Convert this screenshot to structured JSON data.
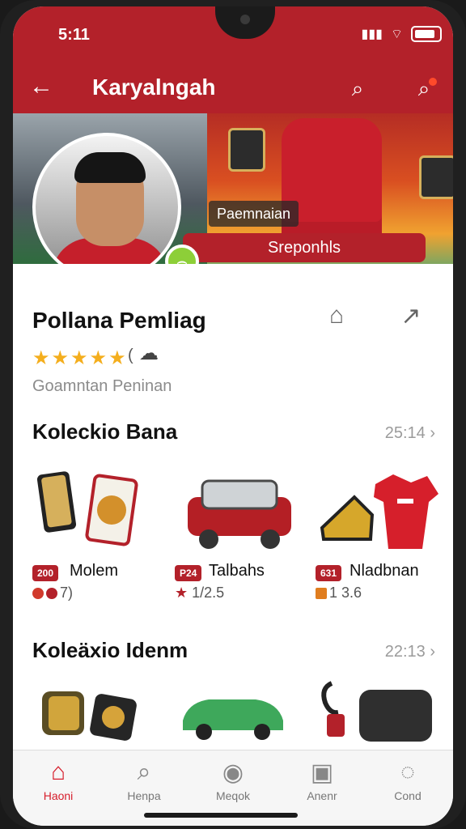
{
  "status_bar": {
    "time": "5:11",
    "signal_icon": "signal-icon",
    "wifi_icon": "wifi-icon",
    "battery_icon": "battery-icon"
  },
  "app_bar": {
    "title": "Karyalngah",
    "back_icon": "back-arrow-icon",
    "search_icon": "search-icon",
    "search_alt_icon": "search-notification-icon"
  },
  "hero": {
    "caption_top": "Paemnaian",
    "caption_bottom": "Sreponhls",
    "status_icon": "status-badge-icon"
  },
  "profile": {
    "name": "Pollana Pemliag",
    "stars": "★★★★★",
    "rating_meta": "(",
    "rating_icon": "rating-comment-icon",
    "subtitle": "Goamntan Peninan",
    "save_icon": "save-icon",
    "share_icon": "share-icon"
  },
  "section1": {
    "title": "Koleckio Bana",
    "meta": "25:14 ›",
    "items": [
      {
        "tag": "200",
        "label": "Molem",
        "meta": "7)",
        "image": "card-pack-image"
      },
      {
        "tag": "P24",
        "label": "Talbahs",
        "meta": "1/2.5",
        "image": "car-model-image"
      },
      {
        "tag": "631",
        "label": "Nladbnan",
        "meta": "1 3.6",
        "image": "jersey-shoe-image"
      }
    ]
  },
  "section2": {
    "title": "Koleäxio Idenm",
    "meta": "22:13 ›"
  },
  "bottom_nav": {
    "items": [
      {
        "label": "Haoni",
        "icon": "home-icon"
      },
      {
        "label": "Henpa",
        "icon": "search-icon"
      },
      {
        "label": "Meqok",
        "icon": "camera-icon"
      },
      {
        "label": "Anenr",
        "icon": "collection-icon"
      },
      {
        "label": "Cond",
        "icon": "profile-icon"
      }
    ]
  }
}
